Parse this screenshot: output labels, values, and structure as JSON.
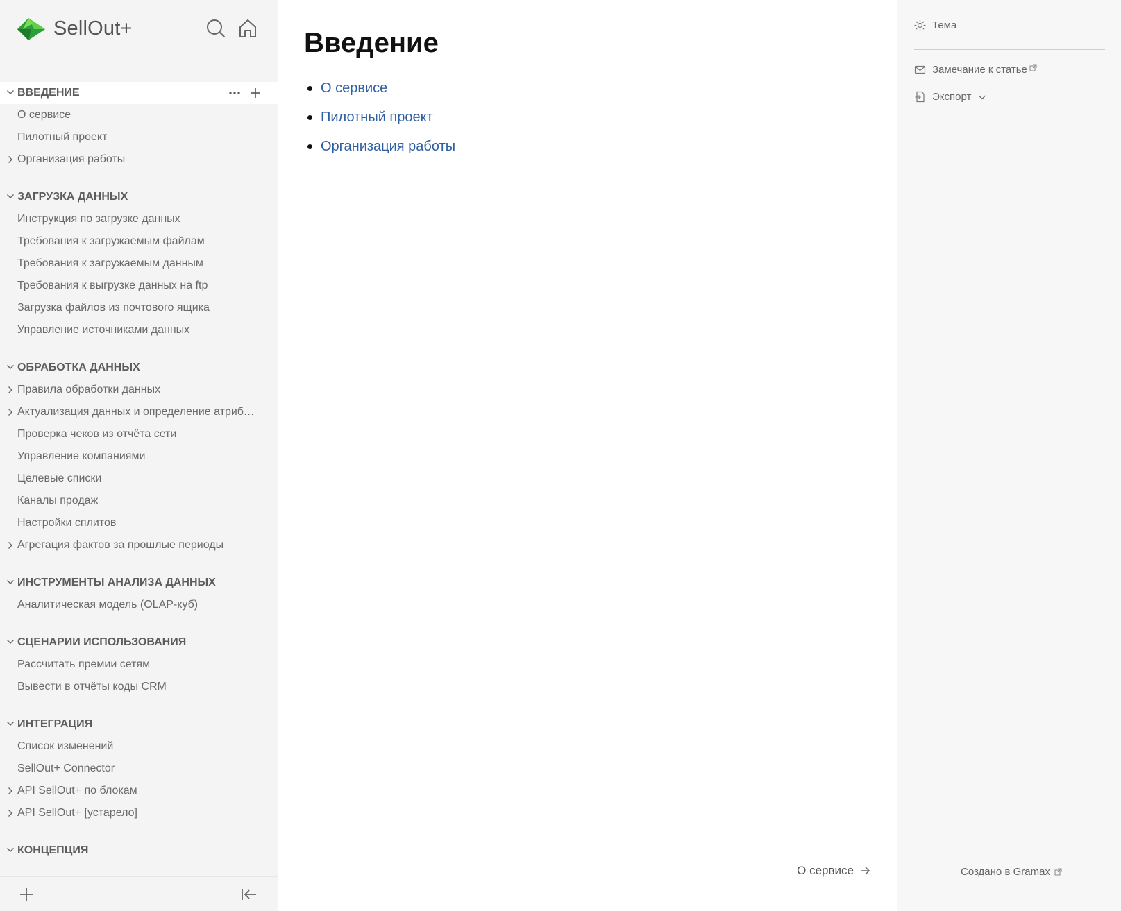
{
  "app": {
    "title": "SellOut+"
  },
  "sidebar": {
    "sections": [
      {
        "title": "ВВЕДЕНИЕ",
        "active": true,
        "items": [
          {
            "label": "О сервисе",
            "expandable": false
          },
          {
            "label": "Пилотный проект",
            "expandable": false
          },
          {
            "label": "Организация работы",
            "expandable": true
          }
        ]
      },
      {
        "title": "ЗАГРУЗКА ДАННЫХ",
        "items": [
          {
            "label": "Инструкция по загрузке данных",
            "expandable": false
          },
          {
            "label": "Требования к загружаемым файлам",
            "expandable": false
          },
          {
            "label": "Требования к загружаемым данным",
            "expandable": false
          },
          {
            "label": "Требования к выгрузке данных на ftp",
            "expandable": false
          },
          {
            "label": "Загрузка файлов из почтового ящика",
            "expandable": false
          },
          {
            "label": "Управление источниками данных",
            "expandable": false
          }
        ]
      },
      {
        "title": "ОБРАБОТКА ДАННЫХ",
        "items": [
          {
            "label": "Правила обработки данных",
            "expandable": true
          },
          {
            "label": "Актуализация данных и определение атрибу…",
            "expandable": true
          },
          {
            "label": "Проверка чеков из отчёта сети",
            "expandable": false
          },
          {
            "label": "Управление компаниями",
            "expandable": false
          },
          {
            "label": "Целевые списки",
            "expandable": false
          },
          {
            "label": "Каналы продаж",
            "expandable": false
          },
          {
            "label": "Настройки сплитов",
            "expandable": false
          },
          {
            "label": "Агрегация фактов за прошлые периоды",
            "expandable": true
          }
        ]
      },
      {
        "title": "ИНСТРУМЕНТЫ АНАЛИЗА ДАННЫХ",
        "items": [
          {
            "label": "Аналитическая модель (OLAP-куб)",
            "expandable": false
          }
        ]
      },
      {
        "title": "СЦЕНАРИИ ИСПОЛЬЗОВАНИЯ",
        "items": [
          {
            "label": "Рассчитать премии сетям",
            "expandable": false
          },
          {
            "label": "Вывести в отчёты коды CRM",
            "expandable": false
          }
        ]
      },
      {
        "title": "ИНТЕГРАЦИЯ",
        "items": [
          {
            "label": "Список изменений",
            "expandable": false
          },
          {
            "label": "SellOut+ Connector",
            "expandable": false
          },
          {
            "label": "API SellOut+ по блокам",
            "expandable": true
          },
          {
            "label": "API SellOut+ [устарело]",
            "expandable": true
          }
        ]
      },
      {
        "title": "КОНЦЕПЦИЯ",
        "items": []
      }
    ]
  },
  "main": {
    "title": "Введение",
    "links": [
      "О сервисе",
      "Пилотный проект",
      "Организация работы"
    ],
    "next_label": "О сервисе"
  },
  "right_panel": {
    "theme_label": "Тема",
    "feedback_label": "Замечание к статье",
    "export_label": "Экспорт",
    "made_with": "Создано в Gramax"
  },
  "colors": {
    "sidebar_bg": "#f4f4f4",
    "link": "#2f5fa3",
    "brand_green": "#3cb043"
  }
}
